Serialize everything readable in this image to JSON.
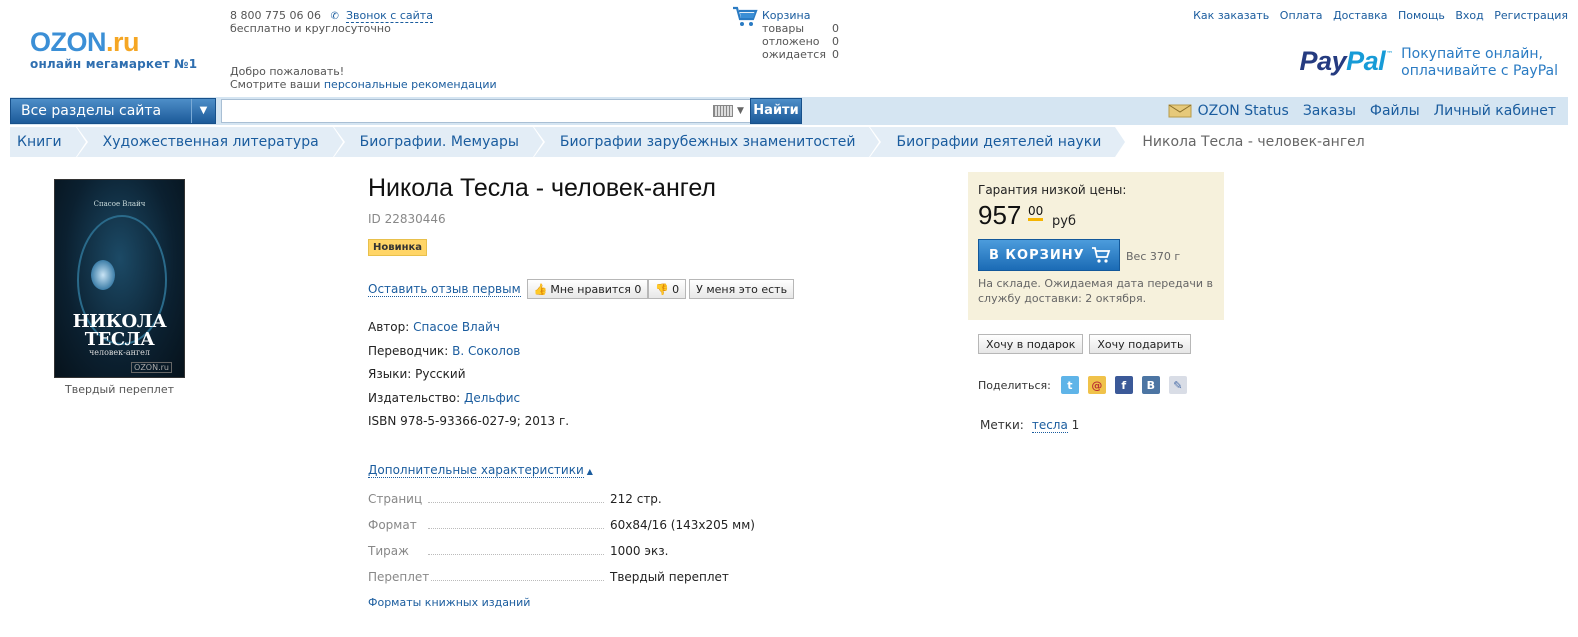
{
  "header": {
    "logo_main": "OZON",
    "logo_ru": ".ru",
    "logo_sub": "онлайн мегамаркет №1",
    "phone": "8 800 775 06 06",
    "callback": "Звонок с сайта",
    "phone_note": "бесплатно и круглосуточно",
    "welcome": "Добро пожаловать!",
    "recs_prefix": "Смотрите ваши",
    "recs_link": "персональные рекомендации",
    "cart": {
      "title": "Корзина",
      "rows": [
        {
          "label": "товары",
          "count": "0"
        },
        {
          "label": "отложено",
          "count": "0"
        },
        {
          "label": "ожидается",
          "count": "0"
        }
      ]
    },
    "top_links": [
      "Как заказать",
      "Оплата",
      "Доставка",
      "Помощь",
      "Вход",
      "Регистрация"
    ],
    "paypal": {
      "logo_pay": "Pay",
      "logo_pal": "Pal",
      "tm": "™",
      "line1": "Покупайте онлайн,",
      "line2": "оплачивайте с PayPal"
    }
  },
  "navbar": {
    "sections": "Все разделы сайта",
    "search_value": "",
    "find": "Найти",
    "links": [
      "OZON Status",
      "Заказы",
      "Файлы",
      "Личный кабинет"
    ]
  },
  "breadcrumbs": [
    "Книги",
    "Художественная литература",
    "Биографии. Мемуары",
    "Биографии зарубежных знаменитостей",
    "Биографии деятелей науки",
    "Никола Тесла - человек-ангел"
  ],
  "product": {
    "title": "Никола Тесла - человек-ангел",
    "id": "ID 22830446",
    "badge": "Новинка",
    "review_first": "Оставить отзыв первым",
    "like": "Мне нравится 0",
    "dislike": "0",
    "have": "У меня это есть",
    "cover": {
      "author": "Спасое Влайч",
      "title1": "НИКОЛА",
      "title2": "ТЕСЛА",
      "subtitle": "человек-ангел",
      "brand": "OZON.ru"
    },
    "binding": "Твердый переплет",
    "attrs": [
      {
        "label": "Автор:",
        "value": "Спасое Влайч"
      },
      {
        "label": "Переводчик:",
        "value": "В. Соколов"
      },
      {
        "label": "Языки:",
        "value": "Русский"
      },
      {
        "label": "Издательство:",
        "value": "Дельфис"
      }
    ],
    "isbn": "ISBN 978-5-93366-027-9; 2013 г.",
    "more_link": "Дополнительные характеристики",
    "specs": [
      {
        "k": "Страниц",
        "v": "212 стр."
      },
      {
        "k": "Формат",
        "v": "60x84/16 (143x205 мм)"
      },
      {
        "k": "Тираж",
        "v": "1000 экз."
      },
      {
        "k": "Переплет",
        "v": "Твердый переплет"
      }
    ],
    "formats_link": "Форматы книжных изданий"
  },
  "pricebox": {
    "label": "Гарантия низкой цены:",
    "price": "957",
    "cents": "00",
    "currency": "руб",
    "cart_button": "В КОРЗИНУ",
    "weight": "Вес 370 г",
    "stock": "На складе. Ожидаемая дата передачи в службу доставки: 2 октября.",
    "gift_want": "Хочу в подарок",
    "gift_give": "Хочу подарить",
    "share_label": "Поделиться:",
    "tags_label": "Метки:",
    "tag": "тесла",
    "tag_count": "1"
  },
  "colors": {
    "accent": "#1a5c9e",
    "navbar": "#d5e5f2",
    "pricebox": "#f6f1dc",
    "badge": "#ffd567"
  }
}
